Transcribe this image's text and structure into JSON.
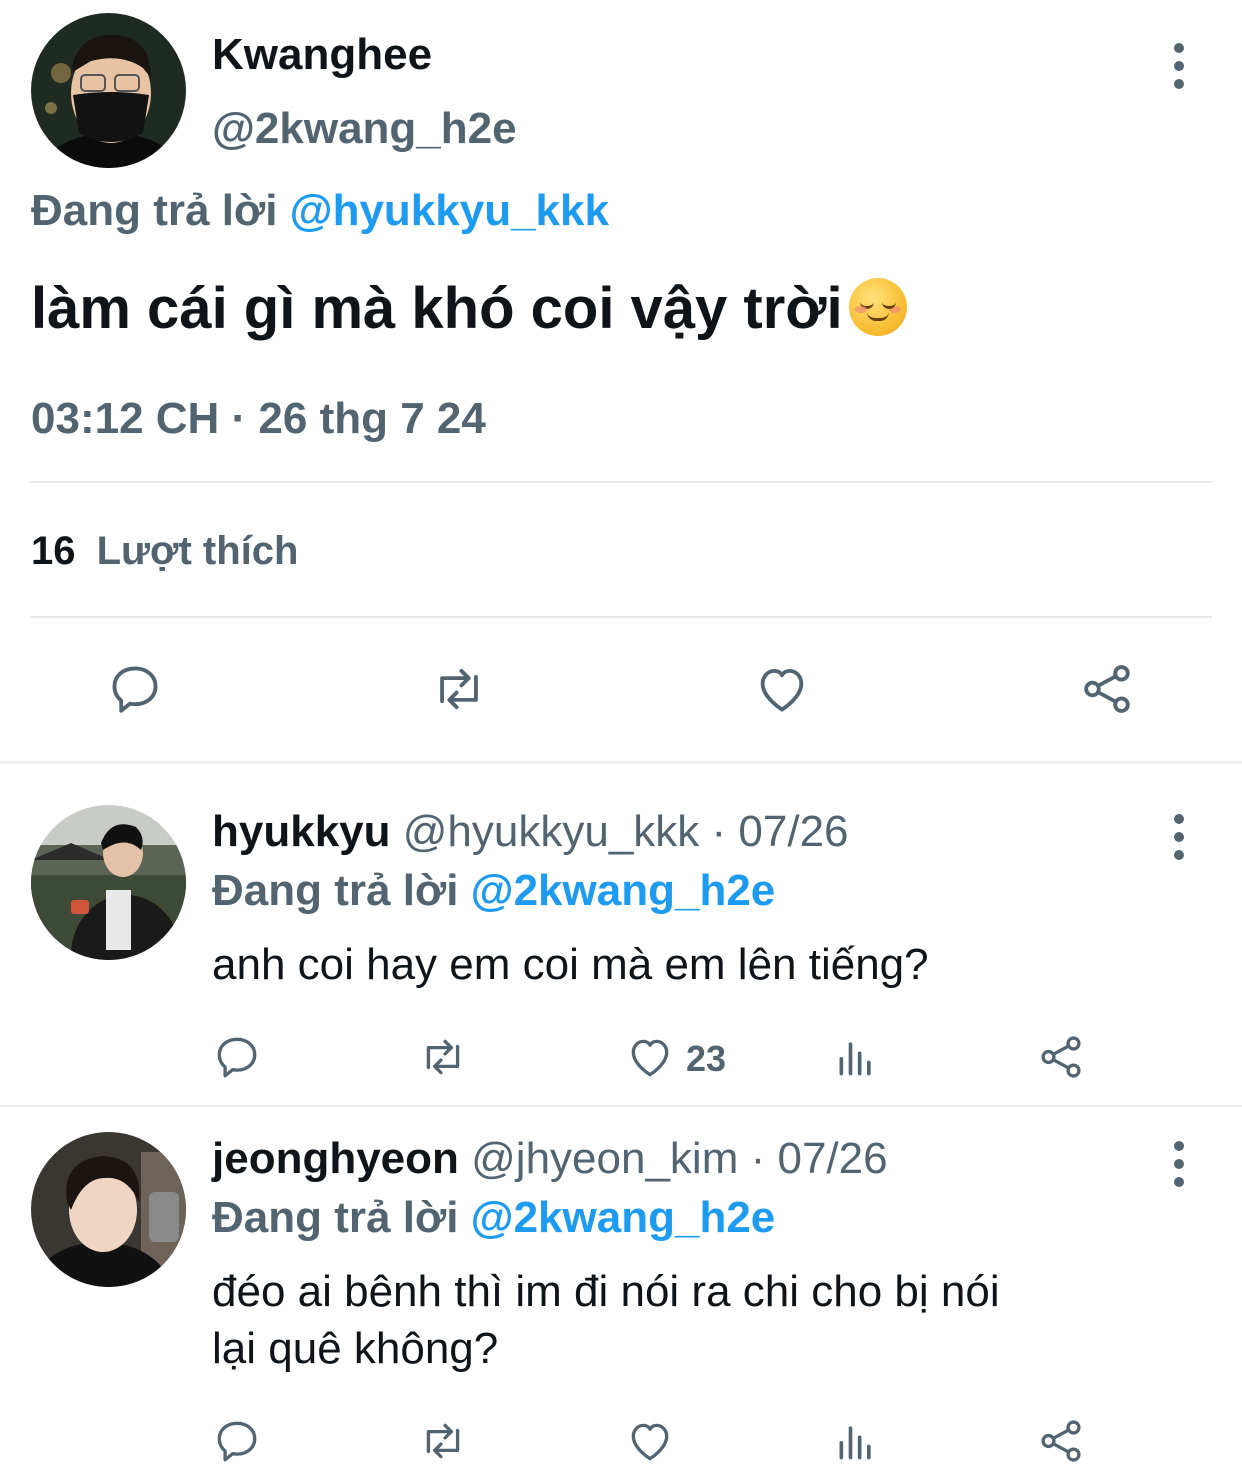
{
  "main_tweet": {
    "display_name": "Kwanghee",
    "handle": "@2kwang_h2e",
    "replying_prefix": "Đang trả lời",
    "replying_to": "@hyukkyu_kkk",
    "text": "làm cái gì mà khó coi vậy trời",
    "emoji": "smiling-face-emoji",
    "timestamp": "03:12 CH · 26 thg 7 24",
    "likes_count": "16",
    "likes_label": "Lượt thích"
  },
  "replies": [
    {
      "display_name": "hyukkyu",
      "handle": "@hyukkyu_kkk",
      "date": "· 07/26",
      "replying_prefix": "Đang trả lời",
      "replying_to": "@2kwang_h2e",
      "text": "anh coi hay em coi mà em lên tiếng?",
      "like_count": "23"
    },
    {
      "display_name": "jeonghyeon",
      "handle": "@jhyeon_kim",
      "date": "· 07/26",
      "replying_prefix": "Đang trả lời",
      "replying_to": "@2kwang_h2e",
      "text_line1": "đéo ai bênh thì im đi nói ra chi cho bị nói",
      "text_line2": "lại quê không?",
      "like_count": ""
    }
  ],
  "colors": {
    "text": "#0f1419",
    "secondary": "#536471",
    "accent": "#1d9bf0",
    "divider": "#e6e9eb"
  },
  "icons": [
    "reply-icon",
    "retweet-icon",
    "like-icon",
    "share-icon",
    "views-icon",
    "more-icon"
  ]
}
